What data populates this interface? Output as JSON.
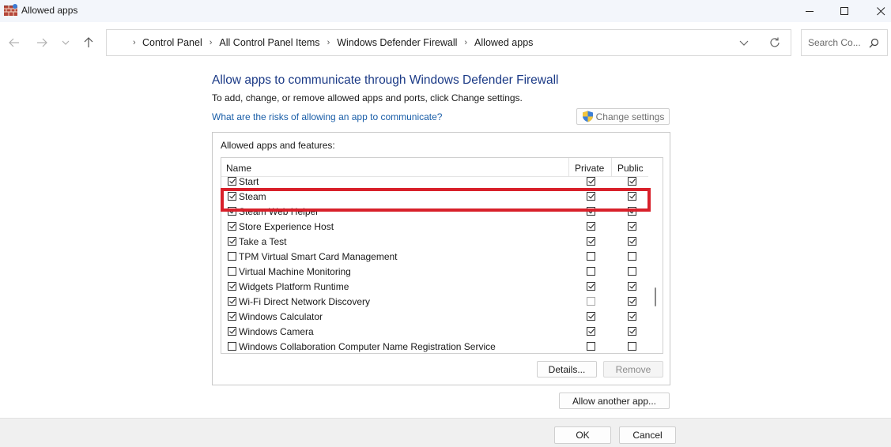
{
  "window": {
    "title": "Allowed apps"
  },
  "address_bar": {
    "breadcrumbs": [
      "Control Panel",
      "All Control Panel Items",
      "Windows Defender Firewall",
      "Allowed apps"
    ]
  },
  "search": {
    "placeholder": "Search Co..."
  },
  "page": {
    "heading": "Allow apps to communicate through Windows Defender Firewall",
    "subtitle": "To add, change, or remove allowed apps and ports, click Change settings.",
    "risk_link": "What are the risks of allowing an app to communicate?",
    "change_settings_label": "Change settings"
  },
  "apps_group": {
    "label": "Allowed apps and features:",
    "columns": {
      "name": "Name",
      "private": "Private",
      "public": "Public"
    },
    "rows": [
      {
        "name": "Start",
        "enabled": true,
        "private": true,
        "public": true
      },
      {
        "name": "Steam",
        "enabled": true,
        "private": true,
        "public": true
      },
      {
        "name": "Steam Web Helper",
        "enabled": true,
        "private": true,
        "public": true
      },
      {
        "name": "Store Experience Host",
        "enabled": true,
        "private": true,
        "public": true
      },
      {
        "name": "Take a Test",
        "enabled": true,
        "private": true,
        "public": true
      },
      {
        "name": "TPM Virtual Smart Card Management",
        "enabled": false,
        "private": false,
        "public": false
      },
      {
        "name": "Virtual Machine Monitoring",
        "enabled": false,
        "private": false,
        "public": false
      },
      {
        "name": "Widgets Platform Runtime",
        "enabled": true,
        "private": true,
        "public": true
      },
      {
        "name": "Wi-Fi Direct Network Discovery",
        "enabled": true,
        "private": false,
        "public": true
      },
      {
        "name": "Windows Calculator",
        "enabled": true,
        "private": true,
        "public": true
      },
      {
        "name": "Windows Camera",
        "enabled": true,
        "private": true,
        "public": true
      },
      {
        "name": "Windows Collaboration Computer Name Registration Service",
        "enabled": false,
        "private": false,
        "public": false
      }
    ],
    "details_label": "Details...",
    "remove_label": "Remove"
  },
  "allow_another_label": "Allow another app...",
  "footer": {
    "ok_label": "OK",
    "cancel_label": "Cancel"
  },
  "colors": {
    "heading": "#1b3a86",
    "link": "#1a5ea8",
    "highlight": "#d8202a"
  },
  "highlighted_row": "Steam"
}
